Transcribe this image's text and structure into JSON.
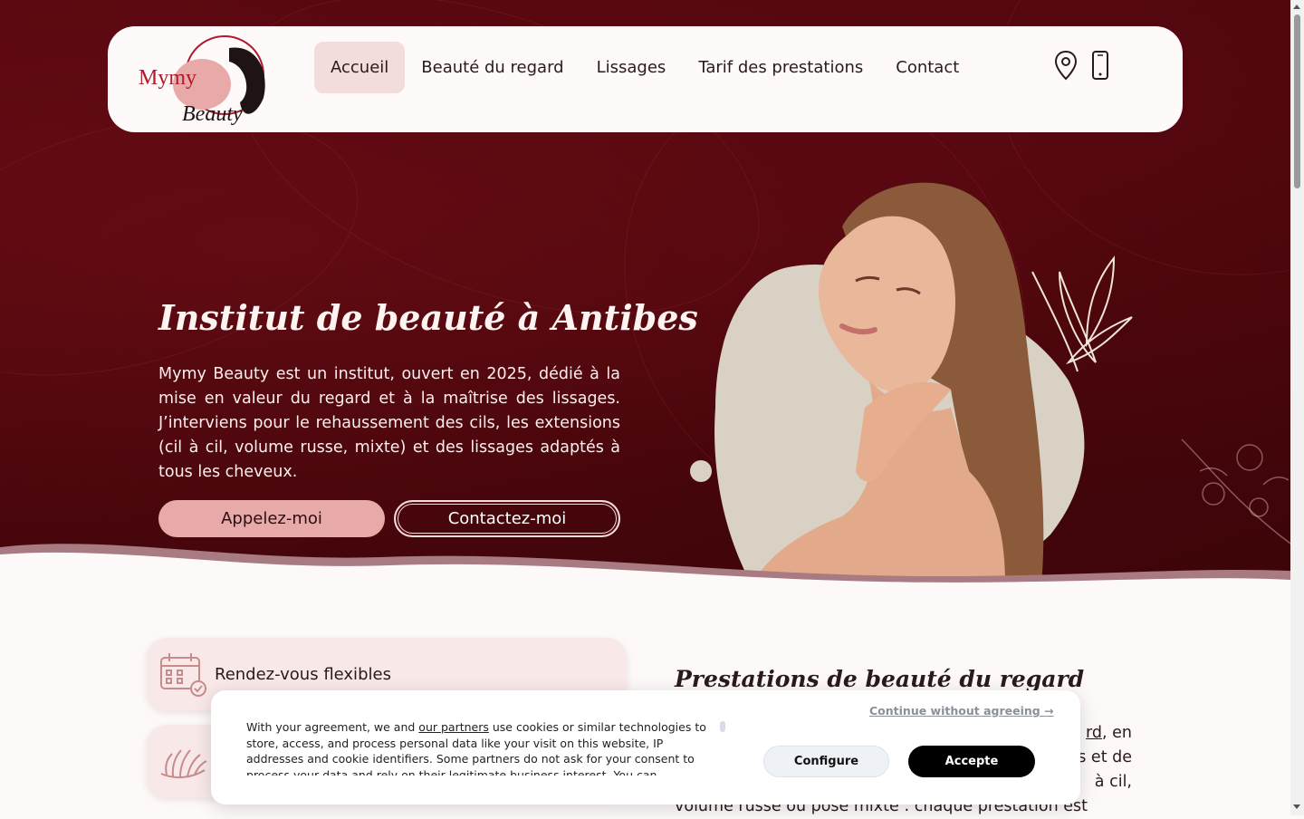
{
  "nav": {
    "logo_text_1": "Mymy",
    "logo_text_2": "Beauty",
    "items": [
      {
        "label": "Accueil",
        "active": true
      },
      {
        "label": "Beauté du regard",
        "active": false
      },
      {
        "label": "Lissages",
        "active": false
      },
      {
        "label": "Tarif des prestations",
        "active": false
      },
      {
        "label": "Contact",
        "active": false
      }
    ],
    "icons": [
      "location-pin-icon",
      "mobile-phone-icon"
    ]
  },
  "hero": {
    "title": "Institut de beauté à Antibes",
    "text": "Mymy Beauty est un institut, ouvert en 2025, dédié à la mise en valeur du regard et à la maîtrise des lissages. J’interviens pour le rehaussement des cils, les extensions (cil à cil, volume russe, mixte) et des lissages adaptés à tous les cheveux.",
    "call_button": "Appelez-moi",
    "contact_button": "Contactez-moi"
  },
  "features": [
    {
      "label": "Rendez-vous flexibles",
      "icon": "calendar-check-icon"
    },
    {
      "label": "",
      "icon": "eyelash-icon"
    }
  ],
  "section": {
    "title": "Prestations de beauté du regard",
    "line1_end": "rd",
    "line1_tail": ", en",
    "line2_tail": "s et de",
    "line3_tail": "à cil,",
    "line4": "volume russe ou pose mixte : chaque prestation est"
  },
  "cookie": {
    "text_before_link": "With your agreement, we and ",
    "link": "our partners",
    "text_after_link": " use cookies or similar technologies to store, access, and process personal data like your visit on this website, IP addresses and cookie identifiers. Some partners do not ask for your consent to process your data and rely on their legitimate business interest. You can",
    "continue_without": "Continue without agreeing →",
    "configure": "Configure",
    "accept": "Accepte"
  },
  "colors": {
    "hero_bg": "#4a060c",
    "nav_active": "#f2dcdc",
    "button_pink": "#e8aaa9",
    "card_bg": "#f8e9e8",
    "blob": "#d9d2c4"
  }
}
